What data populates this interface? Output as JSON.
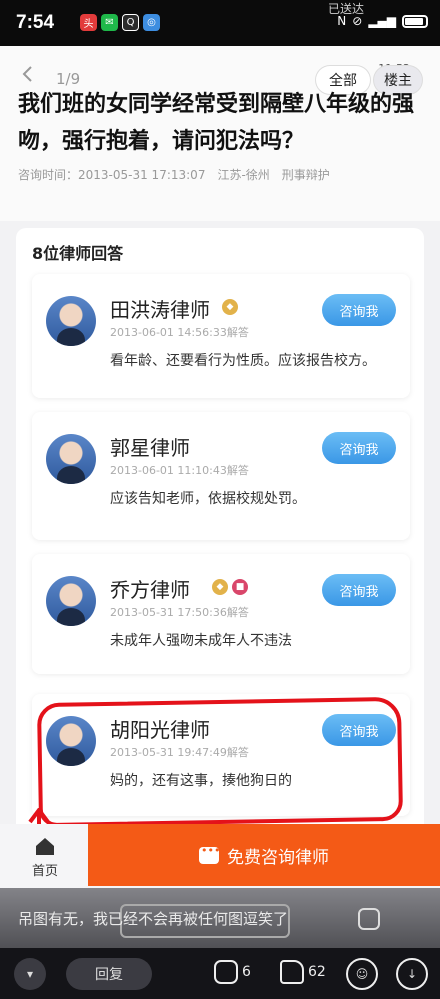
{
  "status_bar": {
    "time": "7:54",
    "sent_label": "已送达"
  },
  "header": {
    "page_counter": "1/9",
    "inner_status_right": "11:52",
    "filter_all": "全部",
    "filter_owner": "楼主"
  },
  "question": {
    "title": "我们班的女同学经常受到隔壁八年级的强吻，强行抱着，请问犯法吗？",
    "time": "咨询时间：2013-05-31 17:13:07",
    "location": "江苏-徐州",
    "category": "刑事辩护"
  },
  "answers": {
    "heading": "8位律师回答",
    "consult_label": "咨询我",
    "items": [
      {
        "name": "田洪涛律师",
        "time": "2013-06-01 14:56:33解答",
        "text": "看年龄、还要看行为性质。应该报告校方。"
      },
      {
        "name": "郭星律师",
        "time": "2013-06-01 11:10:43解答",
        "text": "应该告知老师，依据校规处罚。"
      },
      {
        "name": "乔方律师",
        "time": "2013-05-31 17:50:36解答",
        "text": "未成年人强吻未成年人不违法"
      },
      {
        "name": "胡阳光律师",
        "time": "2013-05-31 19:47:49解答",
        "text": "妈的，还有这事，揍他狗日的"
      }
    ]
  },
  "bottom_bar": {
    "home_label": "首页",
    "free_consult_label": "免费咨询律师"
  },
  "comment": {
    "text": "吊图有无，我已经不会再被任何图逗笑了",
    "reply_label": "回复",
    "comment_count": "6",
    "like_count": "62"
  },
  "colors": {
    "accent_orange": "#f45a16",
    "consult_blue": "#3a97e6",
    "highlight_red": "#e4121a"
  }
}
